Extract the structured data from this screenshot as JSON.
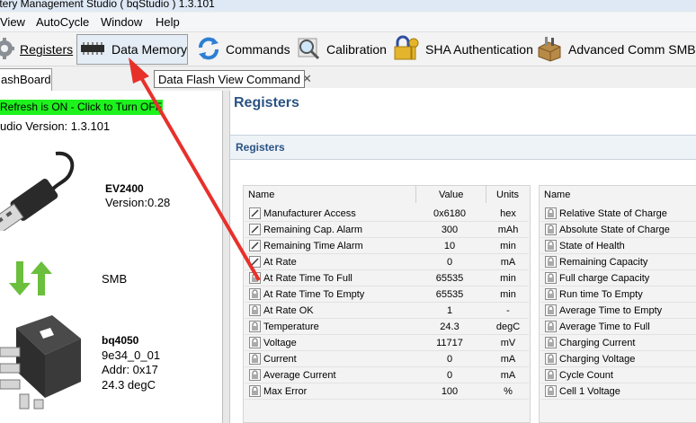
{
  "window": {
    "title": "ttery Management Studio ( bqStudio ) 1.3.101"
  },
  "menu": [
    "View",
    "AutoCycle",
    "Window",
    "Help"
  ],
  "toolbar": [
    {
      "label": "Registers",
      "icon": "gear-icon"
    },
    {
      "label": "Data Memory",
      "icon": "chip-icon"
    },
    {
      "label": "Commands",
      "icon": "refresh-arrows-icon"
    },
    {
      "label": "Calibration",
      "icon": "magnifier-icon"
    },
    {
      "label": "SHA Authentication",
      "icon": "lock-key-icon"
    },
    {
      "label": "Advanced Comm SMB",
      "icon": "toolbox-icon"
    }
  ],
  "tooltip": "Data Flash View Command",
  "tab": {
    "label": "ashBoard"
  },
  "dashboard": {
    "refresh": "Refresh is ON - Click to Turn OFF",
    "version": "udio Version:  1.3.101",
    "adapter": {
      "name": "EV2400",
      "version": "Version:0.28"
    },
    "bus": "SMB",
    "device": {
      "name": "bq4050",
      "fw": "9e34_0_01",
      "addr": "Addr: 0x17",
      "temp": "24.3 degC"
    }
  },
  "main": {
    "title": "Registers",
    "section": "Registers"
  },
  "table_left": {
    "headers": {
      "name": "Name",
      "value": "Value",
      "units": "Units"
    },
    "rows": [
      {
        "name": "Manufacturer Access",
        "value": "0x6180",
        "units": "hex",
        "icon": "edit-icon"
      },
      {
        "name": "Remaining Cap. Alarm",
        "value": "300",
        "units": "mAh",
        "icon": "edit-icon"
      },
      {
        "name": "Remaining Time Alarm",
        "value": "10",
        "units": "min",
        "icon": "edit-icon"
      },
      {
        "name": "At Rate",
        "value": "0",
        "units": "mA",
        "icon": "edit-icon"
      },
      {
        "name": "At Rate Time To Full",
        "value": "65535",
        "units": "min",
        "icon": "lock-icon"
      },
      {
        "name": "At Rate Time To Empty",
        "value": "65535",
        "units": "min",
        "icon": "lock-icon"
      },
      {
        "name": "At Rate OK",
        "value": "1",
        "units": "-",
        "icon": "lock-icon"
      },
      {
        "name": "Temperature",
        "value": "24.3",
        "units": "degC",
        "icon": "lock-icon"
      },
      {
        "name": "Voltage",
        "value": "11717",
        "units": "mV",
        "icon": "lock-icon"
      },
      {
        "name": "Current",
        "value": "0",
        "units": "mA",
        "icon": "lock-icon"
      },
      {
        "name": "Average Current",
        "value": "0",
        "units": "mA",
        "icon": "lock-icon"
      },
      {
        "name": "Max Error",
        "value": "100",
        "units": "%",
        "icon": "lock-icon"
      }
    ]
  },
  "table_right": {
    "headers": {
      "name": "Name"
    },
    "rows": [
      "Relative State of Charge",
      "Absolute State of Charge",
      "State of Health",
      "Remaining Capacity",
      "Full charge Capacity",
      "Run time To Empty",
      "Average Time to Empty",
      "Average Time to Full",
      "Charging Current",
      "Charging Voltage",
      "Cycle Count",
      "Cell 1 Voltage"
    ]
  },
  "colors": {
    "refresh_bg": "#1df21d",
    "title_blue": "#2a5384",
    "annotation_arrow": "#e8302a"
  }
}
